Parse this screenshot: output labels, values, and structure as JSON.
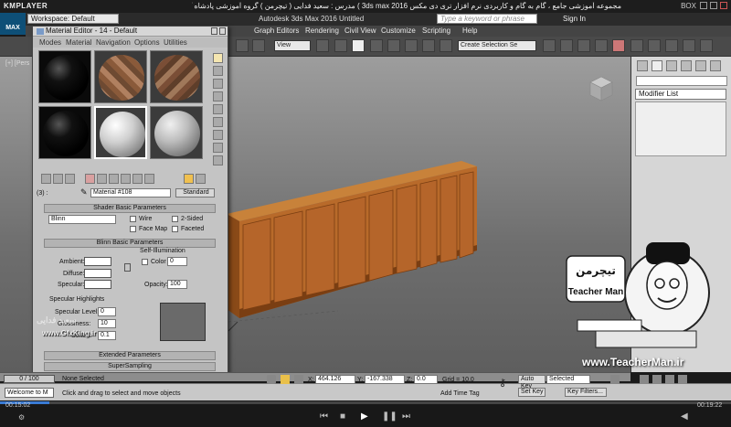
{
  "player": {
    "logo": "KMPLAYER",
    "title": "مجموعه آموزشی جامع ، گام به گام و کاربردی نرم افزار تری دی مکس 3ds max 2016 ) مدرس : سعید فدایی ( تیچرمن ) گروه آموزشی پادشاه گرافیست ها",
    "box_label": "BOX",
    "time_elapsed": "00:15:02",
    "time_total": "00:19:22"
  },
  "max": {
    "logo": "MAX",
    "workspace": "Workspace: Default",
    "app_title": "Autodesk 3ds Max 2016    Untitled",
    "search_placeholder": "Type a keyword or phrase",
    "signin": "Sign In",
    "menus": [
      "Graph Editors",
      "Rendering",
      "Civil View",
      "Customize",
      "Scripting",
      "Help"
    ],
    "toolbar": {
      "view_select": "View",
      "selection_set": "Create Selection Se"
    },
    "viewport_label": "[+] [Pers"
  },
  "command_panel": {
    "modifier_list": "Modifier List"
  },
  "material_editor": {
    "title": "Material Editor - 14 - Default",
    "menus": [
      "Modes",
      "Material",
      "Navigation",
      "Options",
      "Utilities"
    ],
    "slot_index": "(3) :",
    "material_name": "Material #108",
    "material_type": "Standard",
    "shader_rollout": "Shader Basic Parameters",
    "shader_type": "Blinn",
    "checkboxes": [
      "Wire",
      "2-Sided",
      "Face Map",
      "Faceted"
    ],
    "blinn_rollout": "Blinn Basic Parameters",
    "self_illum": "Self-Illumination",
    "color_label": "Color",
    "color_value": "0",
    "ambient": "Ambient:",
    "diffuse": "Diffuse:",
    "specular": "Specular:",
    "opacity_label": "Opacity:",
    "opacity_value": "100",
    "spec_highlights": "Specular Highlights",
    "spec_level": "Specular Level:",
    "spec_level_value": "0",
    "glossiness": "Glossiness:",
    "glossiness_value": "10",
    "soften": "Soften:",
    "soften_value": "0.1",
    "extended_rollout": "Extended Parameters",
    "supersampling_rollout": "SuperSampling"
  },
  "status": {
    "maxscript": "Welcome to M",
    "selection": "None Selected",
    "prompt": "Click and drag to select and move objects",
    "x_label": "X:",
    "x_value": "464.126",
    "y_label": "Y:",
    "y_value": "-167.338",
    "z_label": "Z:",
    "z_value": "0.0",
    "grid": "Grid = 10.0",
    "add_time_tag": "Add Time Tag",
    "auto_key": "Auto Key",
    "selected": "Selected",
    "set_key": "Set Key",
    "key_filters": "Key Filters...",
    "time_slider": "0 / 100"
  },
  "watermarks": {
    "gfx": "www.GfxKing.ir",
    "teacherman_url": "www.TeacherMan.ir",
    "teacherman_name": "Teacher Man",
    "teacherman_fa": "تیچرمن",
    "fadaei": "سعید فدایی"
  }
}
